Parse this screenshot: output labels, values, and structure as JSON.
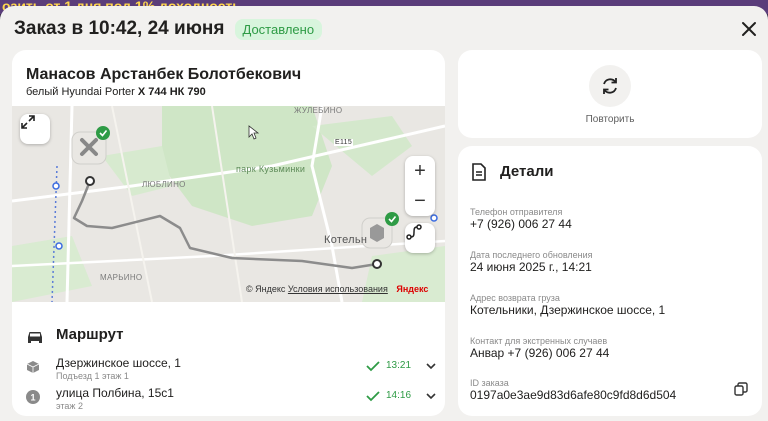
{
  "background_banner": "озить от 1 дня под 1% доходность",
  "order": {
    "title": "Заказ в 10:42, 24 июня",
    "status": "Доставлено"
  },
  "driver": {
    "name": "Манасов Арстанбек Болотбекович",
    "car": "белый Hyundai Porter",
    "plate": "Х 744 НК 790"
  },
  "map": {
    "labels": {
      "zhulebino": "ЖУЛЕБИНО",
      "park": "парк Кузьминки",
      "lyublino": "ЛЮБЛИНО",
      "marino": "МАРЬИНО",
      "kotelniki": "Котельн",
      "road": "E115"
    },
    "copyright": "© Яндекс",
    "terms": "Условия использования",
    "brand": "Яндекс"
  },
  "route": {
    "title": "Маршрут",
    "stops": [
      {
        "address": "Дзержинское шоссе, 1",
        "sub": "Подъезд 1 этаж 1",
        "time": "13:21"
      },
      {
        "number": "1",
        "address": "улица Полбина, 15с1",
        "sub": "этаж 2",
        "time": "14:16"
      }
    ]
  },
  "repeat": {
    "label": "Повторить"
  },
  "details": {
    "title": "Детали",
    "fields": [
      {
        "label": "Телефон отправителя",
        "value": "+7 (926) 006 27 44"
      },
      {
        "label": "Дата последнего обновления",
        "value": "24 июня 2025 г., 14:21"
      },
      {
        "label": "Адрес возврата груза",
        "value": "Котельники, Дзержинское шоссе, 1"
      },
      {
        "label": "Контакт для экстренных случаев",
        "value": "Анвар +7 (926) 006 27 44"
      },
      {
        "label": "ID заказа",
        "value": "0197a0e3ae9d83d6afe80c9fd8d6d504"
      }
    ]
  },
  "colors": {
    "accent_green": "#2e9b45",
    "badge_bg": "#d8f5dd",
    "route_line": "#8c8c8c"
  }
}
